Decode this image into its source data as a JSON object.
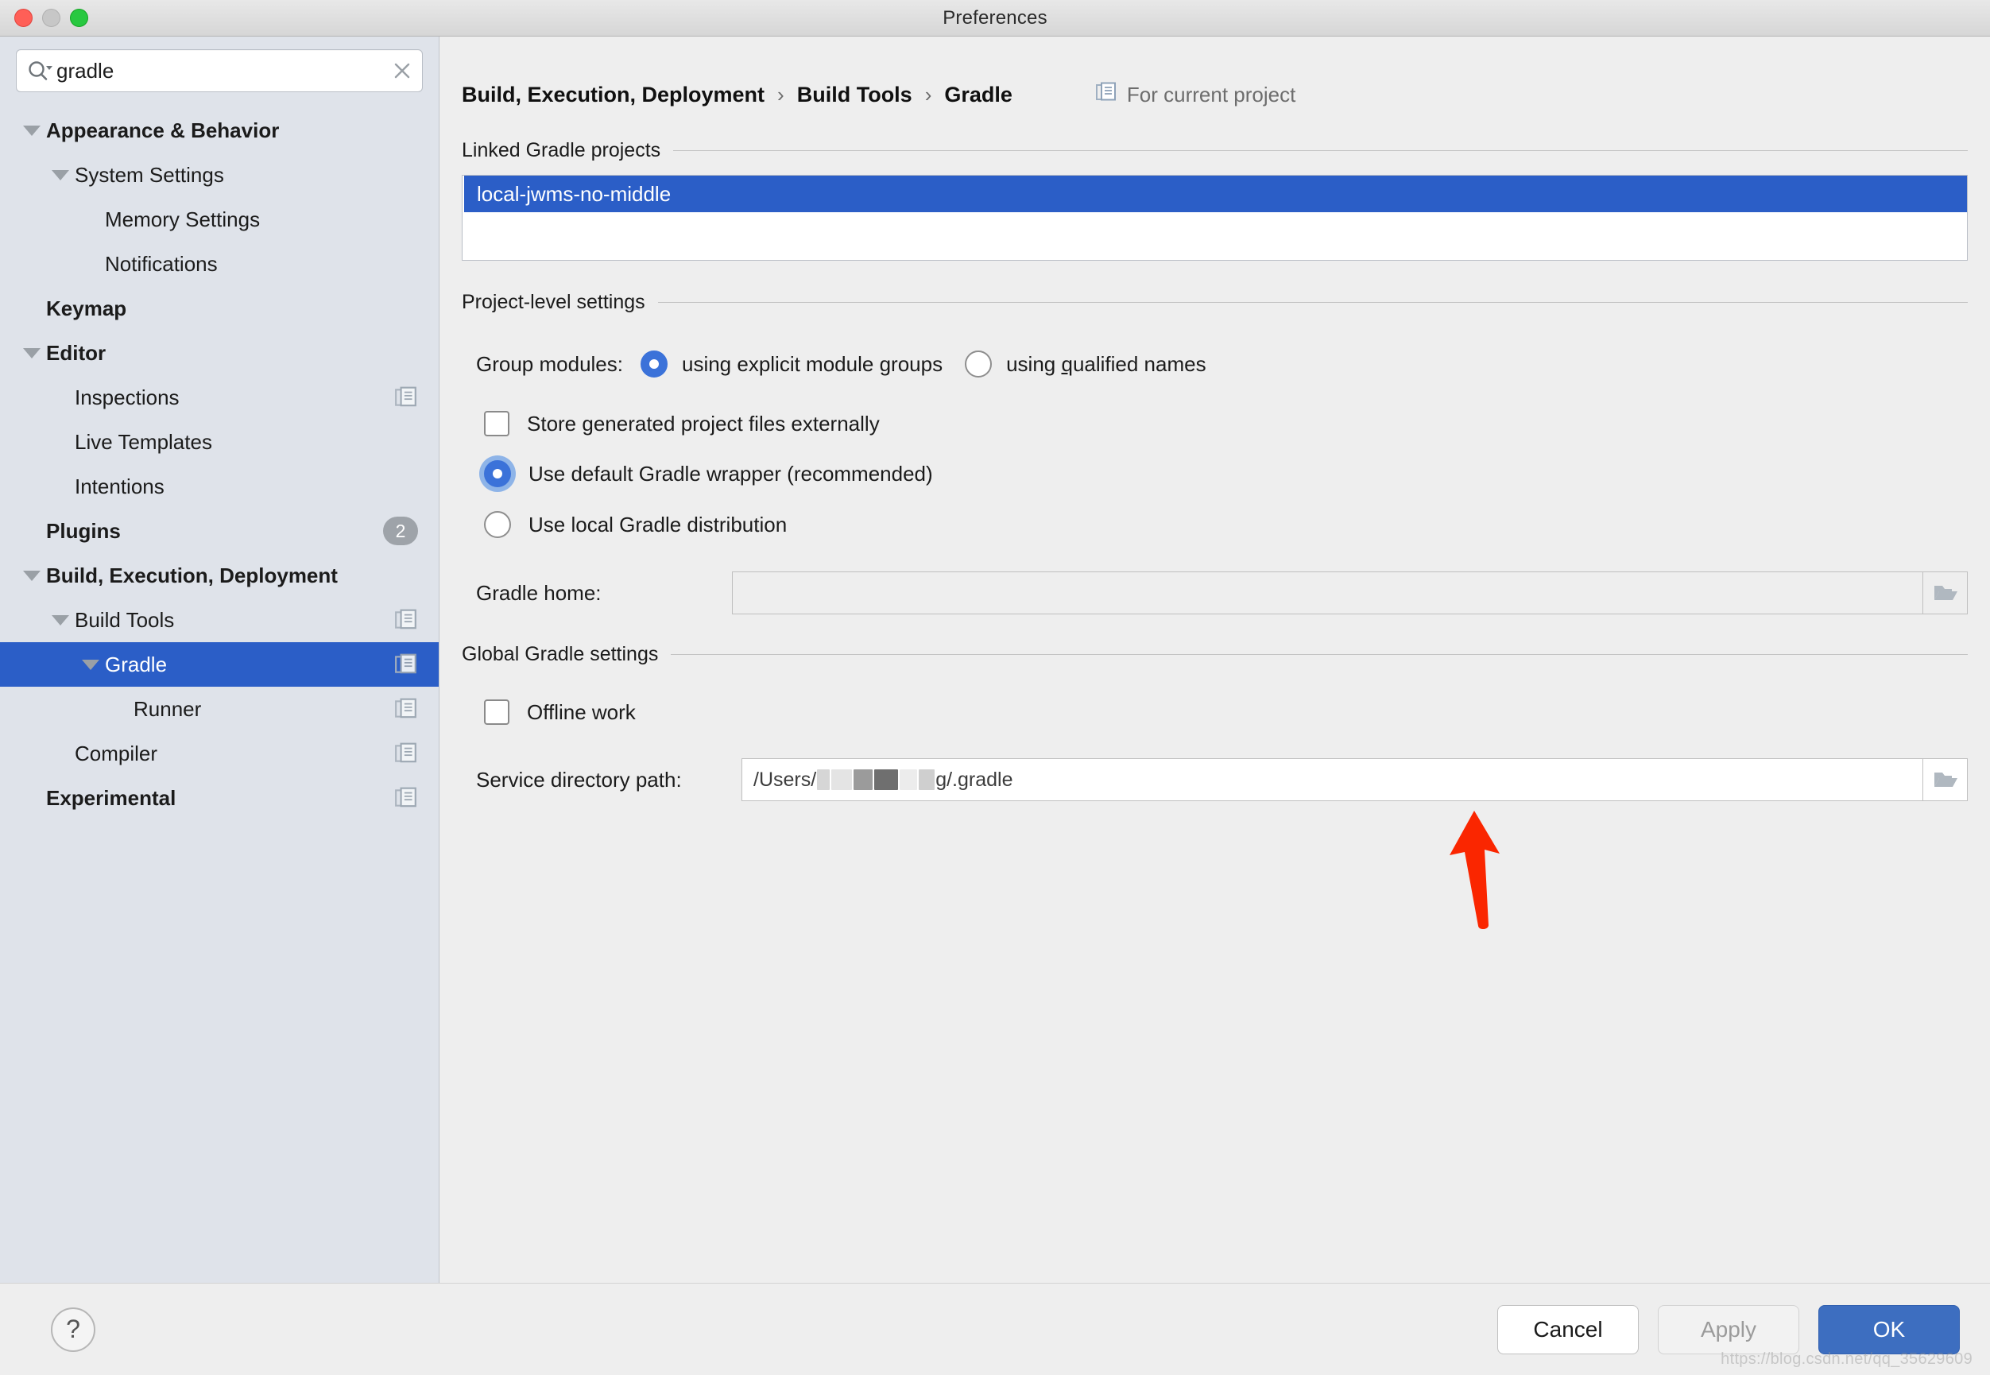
{
  "window": {
    "title": "Preferences",
    "traffic_lights": [
      "close",
      "minimize",
      "zoom"
    ]
  },
  "search": {
    "value": "gradle",
    "placeholder": "",
    "icon": "search-icon",
    "clear_icon": "close-icon"
  },
  "sidebar": {
    "items": [
      {
        "label": "Appearance & Behavior",
        "level": 0,
        "bold": true,
        "twisty": "down",
        "selected": false,
        "trailing": "none"
      },
      {
        "label": "System Settings",
        "level": 1,
        "bold": false,
        "twisty": "down",
        "selected": false,
        "trailing": "none"
      },
      {
        "label": "Memory Settings",
        "level": 2,
        "bold": false,
        "twisty": "none",
        "selected": false,
        "trailing": "none"
      },
      {
        "label": "Notifications",
        "level": 2,
        "bold": false,
        "twisty": "none",
        "selected": false,
        "trailing": "none"
      },
      {
        "label": "Keymap",
        "level": 0,
        "bold": true,
        "twisty": "none",
        "selected": false,
        "trailing": "none"
      },
      {
        "label": "Editor",
        "level": 0,
        "bold": true,
        "twisty": "down",
        "selected": false,
        "trailing": "none"
      },
      {
        "label": "Inspections",
        "level": 1,
        "bold": false,
        "twisty": "none",
        "selected": false,
        "trailing": "project-icon"
      },
      {
        "label": "Live Templates",
        "level": 1,
        "bold": false,
        "twisty": "none",
        "selected": false,
        "trailing": "none"
      },
      {
        "label": "Intentions",
        "level": 1,
        "bold": false,
        "twisty": "none",
        "selected": false,
        "trailing": "none"
      },
      {
        "label": "Plugins",
        "level": 0,
        "bold": true,
        "twisty": "none",
        "selected": false,
        "trailing": "badge",
        "badge": "2"
      },
      {
        "label": "Build, Execution, Deployment",
        "level": 0,
        "bold": true,
        "twisty": "down",
        "selected": false,
        "trailing": "none"
      },
      {
        "label": "Build Tools",
        "level": 1,
        "bold": false,
        "twisty": "down",
        "selected": false,
        "trailing": "project-icon"
      },
      {
        "label": "Gradle",
        "level": 2,
        "bold": false,
        "twisty": "down",
        "selected": true,
        "trailing": "project-icon"
      },
      {
        "label": "Runner",
        "level": 3,
        "bold": false,
        "twisty": "none",
        "selected": false,
        "trailing": "project-icon"
      },
      {
        "label": "Compiler",
        "level": 1,
        "bold": false,
        "twisty": "none",
        "selected": false,
        "trailing": "project-icon"
      },
      {
        "label": "Experimental",
        "level": 0,
        "bold": true,
        "twisty": "none",
        "selected": false,
        "trailing": "project-icon"
      }
    ]
  },
  "breadcrumb": {
    "crumbs": [
      "Build, Execution, Deployment",
      "Build Tools",
      "Gradle"
    ],
    "separator": "›",
    "scope_label": "For current project",
    "scope_icon": "project-icon"
  },
  "main": {
    "linked_projects": {
      "title": "Linked Gradle projects",
      "items": [
        "local-jwms-no-middle"
      ],
      "selected_index": 0
    },
    "project_level": {
      "title": "Project-level settings",
      "group_modules_label": "Group modules:",
      "group_modules_options": [
        {
          "label": "using explicit module groups",
          "mnemonic": "g",
          "checked": true
        },
        {
          "label": "using qualified names",
          "mnemonic": "q",
          "checked": false
        }
      ],
      "store_external": {
        "label": "Store generated project files externally",
        "checked": false
      },
      "distribution_options": [
        {
          "label": "Use default Gradle wrapper (recommended)",
          "checked": true,
          "focused": true
        },
        {
          "label": "Use local Gradle distribution",
          "checked": false,
          "focused": false
        }
      ],
      "gradle_home": {
        "label": "Gradle home:",
        "value": "",
        "browse_icon": "folder-icon"
      }
    },
    "global_settings": {
      "title": "Global Gradle settings",
      "offline_work": {
        "label": "Offline work",
        "checked": false
      },
      "service_directory": {
        "label": "Service directory path:",
        "value_prefix": "/Users/",
        "value_redacted": true,
        "value_suffix": "g/.gradle",
        "browse_icon": "folder-icon"
      }
    },
    "annotation": {
      "type": "arrow-up",
      "color": "#fa2600"
    }
  },
  "footer": {
    "help_label": "?",
    "cancel_label": "Cancel",
    "apply_label": "Apply",
    "apply_disabled": true,
    "ok_label": "OK"
  },
  "watermark": "https://blog.csdn.net/qq_35629609",
  "colors": {
    "selection_blue": "#2b5ec7",
    "primary_button": "#3d6ec0",
    "sidebar_bg": "#dfe3ea",
    "panel_bg": "#eeeeee",
    "annotation_red": "#fa2600"
  }
}
